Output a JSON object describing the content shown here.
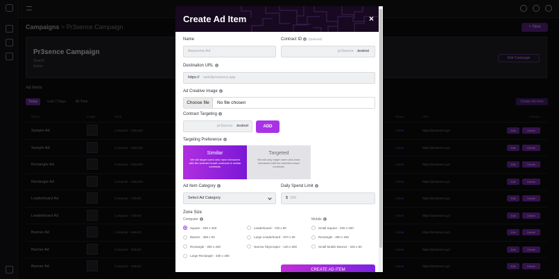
{
  "background": {
    "breadcrumb": "Campaigns",
    "breadcrumb_sub": "> Pr3sence Campaign",
    "new_button": "+ New",
    "campaign_title": "Pr3sence Campaign",
    "campaign_lines": [
      "Search",
      "Active"
    ],
    "campaign_button": "Edit Campaign",
    "ad_items_label": "Ad Items",
    "filters": [
      "Today",
      "Last 7 Days",
      "All Time"
    ],
    "list_button": "Create Ad Item",
    "columns": [
      "Name",
      "Image",
      "Zone",
      "Status",
      "URL",
      "Actions"
    ],
    "rows": [
      {
        "name": "Sample Ad",
        "zone": "Computer - 336x280",
        "status": "Active",
        "url": "https://pr3sence.xyz"
      },
      {
        "name": "Sample Ad",
        "zone": "Computer - 336x280",
        "status": "Active",
        "url": "https://pr3sence.xyz"
      },
      {
        "name": "Rectangle Ad",
        "zone": "Computer - 336x280",
        "status": "Active",
        "url": "https://pr3sence.xyz"
      },
      {
        "name": "Rectangle Ad",
        "zone": "Computer - 336x280",
        "status": "Active",
        "url": "https://pr3sence.xyz"
      },
      {
        "name": "Leaderboard Ad",
        "zone": "Computer - 728x90",
        "status": "Active",
        "url": "https://pr3sence.xyz"
      },
      {
        "name": "Leaderboard Ad",
        "zone": "Computer - 728x90",
        "status": "Active",
        "url": "https://pr3sence.xyz"
      },
      {
        "name": "Banner Ad",
        "zone": "Computer - 468x60",
        "status": "Active",
        "url": "https://pr3sence.xyz"
      },
      {
        "name": "Banner Ad",
        "zone": "Computer - 468x60",
        "status": "Active",
        "url": "https://pr3sence.xyz"
      },
      {
        "name": "Banner Ad",
        "zone": "Computer - 468x60",
        "status": "Active",
        "url": "https://pr3sence.xyz"
      }
    ],
    "row_button_1": "Edit",
    "row_button_2": "Delete"
  },
  "modal": {
    "title": "Create Ad Item",
    "close_symbol": "×",
    "name_label": "Name",
    "name_placeholder": "Awesome Ad",
    "contract_label": "Contract ID",
    "contract_optional": "(Optional)",
    "contract_prefix": "pr3sence",
    "contract_suffix": ".testnet",
    "destination_label": "Destination URL",
    "destination_prefix": "https://",
    "destination_placeholder": "web3presence.app",
    "creative_label": "Ad Creative Image",
    "file_button": "Choose file",
    "file_status": "No file chosen",
    "targeting_label": "Contract Targeting",
    "targeting_prefix": "pr3sence",
    "targeting_suffix": ".testnet",
    "add_button": "ADD",
    "preference_label": "Targeting Preference",
    "similar_title": "Similar",
    "similar_desc": "We will target users who have interacted with the selected smart contracts & similar contracts.",
    "targeted_title": "Targeted",
    "targeted_desc": "We will only target users who have interacted with the selected smart contracts.",
    "category_label": "Ad Item Category",
    "category_value": "Select Ad Category",
    "spend_label": "Daily Spend Limit",
    "spend_prefix": "$",
    "spend_placeholder": "100",
    "zone_size_label": "Zone Size",
    "computer_label": "Computer",
    "mobile_label": "Mobile",
    "computer_col1": [
      "Square - 250 x 250",
      "Banner - 468 x 60",
      "Rectangle - 300 x 250",
      "Large Rectangle - 336 x 280"
    ],
    "computer_col2": [
      "Leaderboard - 728 x 90",
      "Large Leaderboard - 970 x 90",
      "Narrow Skyscraper - 120 x 600"
    ],
    "mobile_col": [
      "Small Square - 200 x 200",
      "Rectangle - 300 x 250",
      "Small Mobile Banner - 320 x 50"
    ],
    "selected_zone": "Square - 250 x 250",
    "create_button": "CREATE AD ITEM"
  },
  "colors": {
    "accent": "#a932e6",
    "header": "#17091f",
    "background": "#0b0b0d"
  }
}
